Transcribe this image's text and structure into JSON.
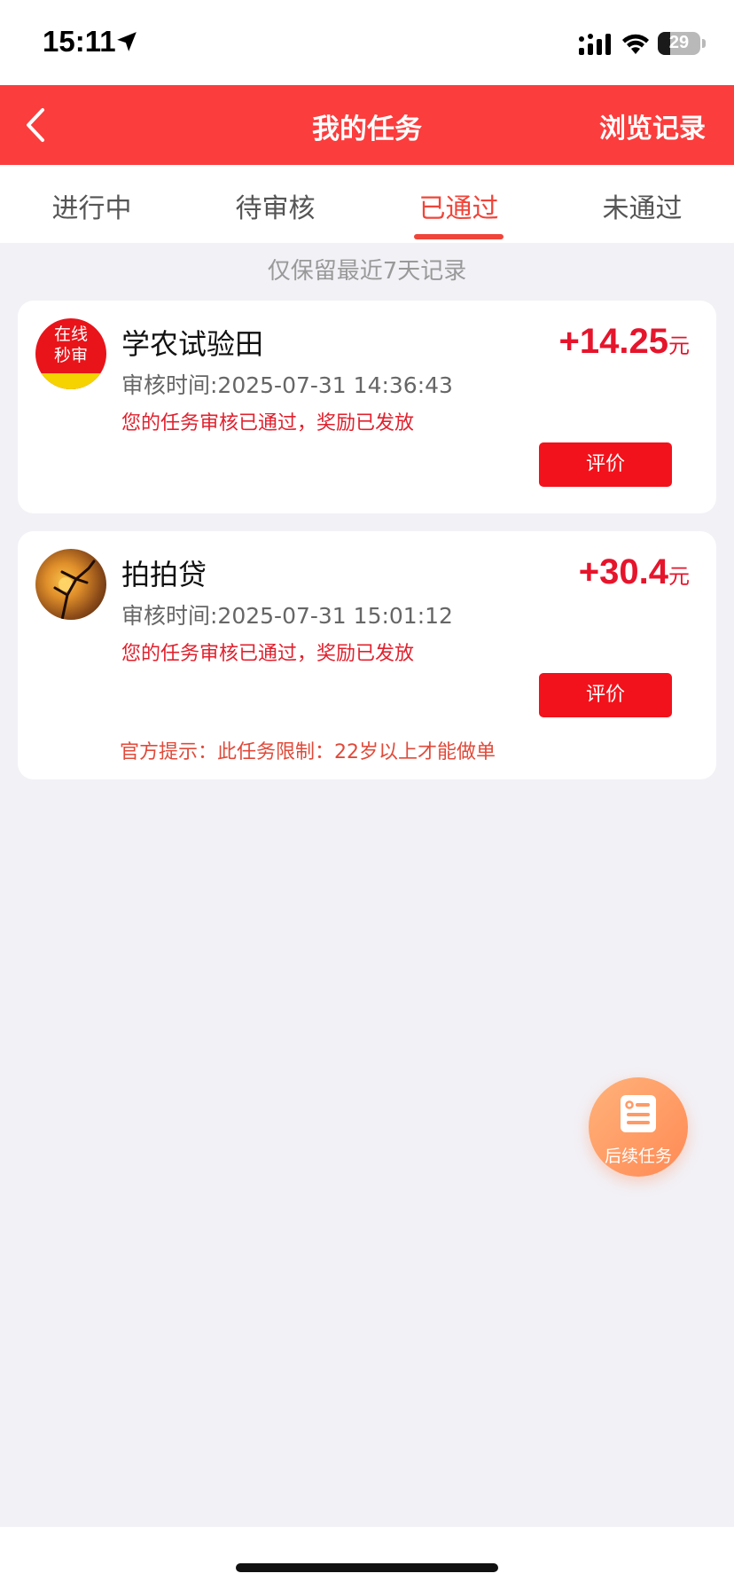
{
  "status_bar": {
    "time": "15:11",
    "battery": "29",
    "battery_level": 0.29
  },
  "header": {
    "title": "我的任务",
    "history_link": "浏览记录"
  },
  "tabs": [
    {
      "label": "进行中",
      "active": false
    },
    {
      "label": "待审核",
      "active": false
    },
    {
      "label": "已通过",
      "active": true
    },
    {
      "label": "未通过",
      "active": false
    }
  ],
  "notice": "仅保留最近7天记录",
  "tasks": [
    {
      "title": "学农试验田",
      "reward": "+14.25",
      "unit": "元",
      "time": "审核时间:2025-07-31 14:36:43",
      "status": "您的任务审核已通过，奖励已发放",
      "button": "评价",
      "avatar_text": [
        "在线",
        "秒审"
      ]
    },
    {
      "title": "拍拍贷",
      "reward": "+30.4",
      "unit": "元",
      "time": "审核时间:2025-07-31 15:01:12",
      "status": "您的任务审核已通过，奖励已发放",
      "button": "评价",
      "tip": "官方提示：此任务限制：22岁以上才能做单"
    }
  ],
  "fab": {
    "label": "后续任务"
  },
  "colors": {
    "header_red": "#fb3d3d",
    "accent": "#f0453a",
    "button_red": "#f2121b",
    "reward_red": "#e5152c",
    "fab_orange": "#ff8a55",
    "background": "#f2f1f6"
  }
}
